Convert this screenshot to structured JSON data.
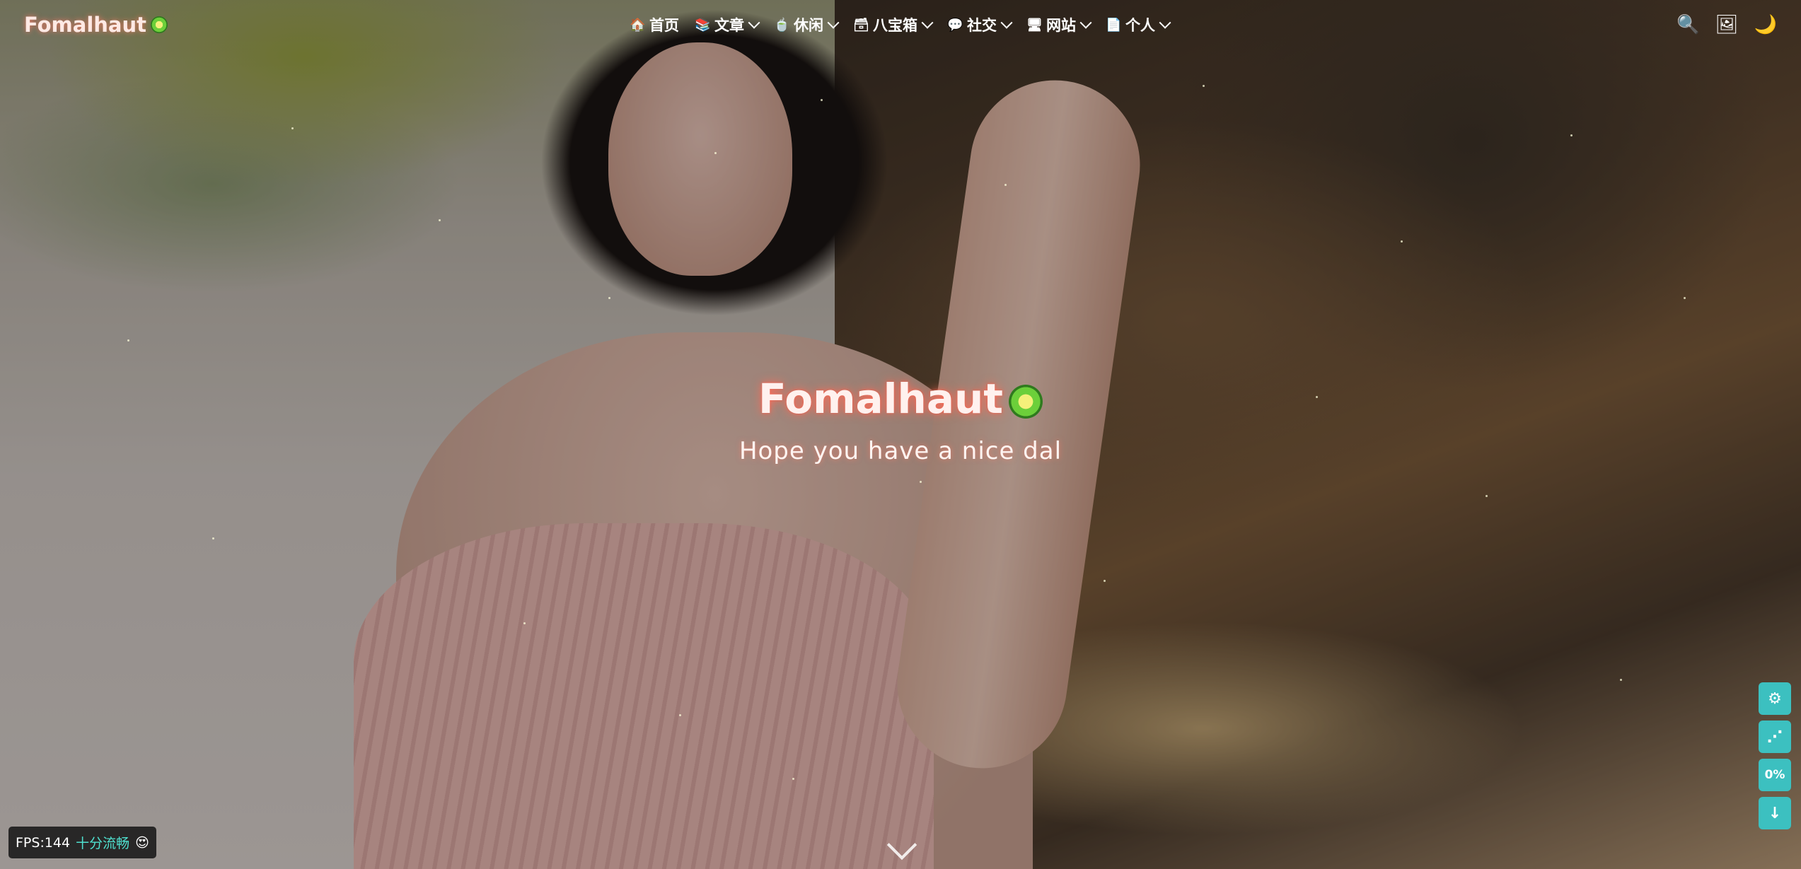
{
  "header": {
    "brand": "Fomalhaut",
    "nav": [
      {
        "label": "首页",
        "icon": "home-icon",
        "glyph": "🏠",
        "has_dropdown": false
      },
      {
        "label": "文章",
        "icon": "book-icon",
        "glyph": "📚",
        "has_dropdown": true
      },
      {
        "label": "休闲",
        "icon": "teacup-icon",
        "glyph": "🍵",
        "has_dropdown": true
      },
      {
        "label": "八宝箱",
        "icon": "box-icon",
        "glyph": "🗃",
        "has_dropdown": true
      },
      {
        "label": "社交",
        "icon": "chat-icon",
        "glyph": "💬",
        "has_dropdown": true
      },
      {
        "label": "网站",
        "icon": "window-icon",
        "glyph": "🖥",
        "has_dropdown": true
      },
      {
        "label": "个人",
        "icon": "document-icon",
        "glyph": "📄",
        "has_dropdown": true
      }
    ],
    "right_icons": [
      {
        "name": "search-icon",
        "glyph": "🔍"
      },
      {
        "name": "picture-icon",
        "glyph": "🖼"
      },
      {
        "name": "moon-icon",
        "glyph": "🌙"
      }
    ]
  },
  "hero": {
    "title": "Fomalhaut",
    "subtitle": "Hope you have a nice dal"
  },
  "rightside": [
    {
      "name": "settings-icon",
      "glyph": "⚙"
    },
    {
      "name": "share-icon",
      "glyph": "⋰"
    },
    {
      "name": "progress-percent",
      "glyph": "0%"
    },
    {
      "name": "arrow-down-icon",
      "glyph": "↓"
    }
  ],
  "fps": {
    "label": "FPS:144",
    "status": "十分流畅",
    "emoji": "😍"
  },
  "colors": {
    "accent": "#3cc0c0",
    "brand_glow": "#ff6e5a",
    "fps_status": "#4fe0cf"
  }
}
